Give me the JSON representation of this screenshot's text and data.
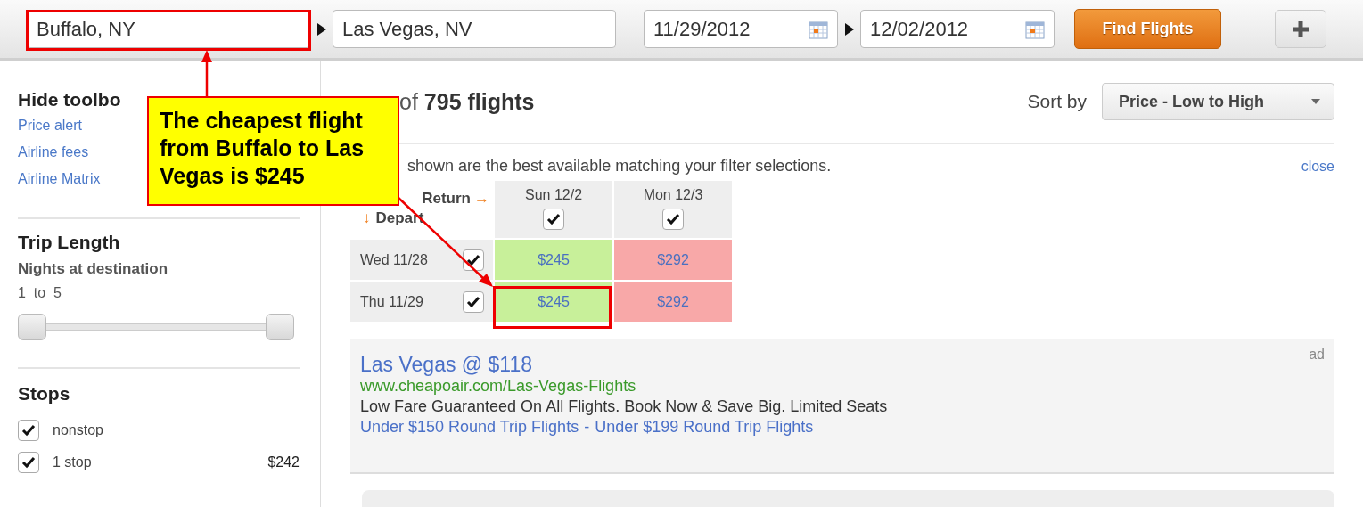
{
  "search": {
    "origin": "Buffalo, NY",
    "destination": "Las Vegas, NV",
    "depart_date": "11/29/2012",
    "return_date": "12/02/2012",
    "find_button": "Find Flights"
  },
  "sidebar": {
    "toolbox_link": "Hide toolbo",
    "links": [
      "Price alert",
      "Airline fees",
      "Airline Matrix"
    ],
    "trip_length": {
      "title": "Trip Length",
      "subtitle": "Nights at destination",
      "range": "1  to  5",
      "level": 1
    },
    "stops": {
      "title": "Stops",
      "options": [
        {
          "label": "nonstop",
          "checked": true
        },
        {
          "label": "1 stop",
          "checked": true,
          "price": "$242"
        }
      ]
    }
  },
  "results": {
    "count_prefix": "of",
    "count": "795 flights",
    "sort_label": "Sort by",
    "sort_value": "Price - Low to High",
    "notice": "shown are the best available matching your filter selections.",
    "close": "close",
    "matrix": {
      "return_label": "Return",
      "return_arrow": "→",
      "depart_arrow": "↓",
      "depart_label": "Depart",
      "columns": [
        {
          "label": "Sun 12/2",
          "checked": true
        },
        {
          "label": "Mon 12/3",
          "checked": true
        }
      ],
      "rows": [
        {
          "label": "Wed 11/28",
          "checked": true,
          "cells": [
            {
              "price": "$245",
              "color": "#c8f09a"
            },
            {
              "price": "$292",
              "color": "#f8a8a8"
            }
          ]
        },
        {
          "label": "Thu 11/29",
          "checked": true,
          "cells": [
            {
              "price": "$245",
              "color": "#c8f09a"
            },
            {
              "price": "$292",
              "color": "#f8a8a8"
            }
          ]
        }
      ]
    }
  },
  "ad": {
    "title": "Las Vegas @ $118",
    "url": "www.cheapoair.com/Las-Vegas-Flights",
    "description": "Low Fare Guaranteed On All Flights. Book Now & Save Big. Limited Seats",
    "links": [
      "Under $150 Round Trip Flights",
      "Under $199 Round Trip Flights"
    ],
    "separator": "-",
    "badge": "ad"
  },
  "annotation": {
    "text": "The cheapest flight from Buffalo to Las Vegas is $245"
  }
}
